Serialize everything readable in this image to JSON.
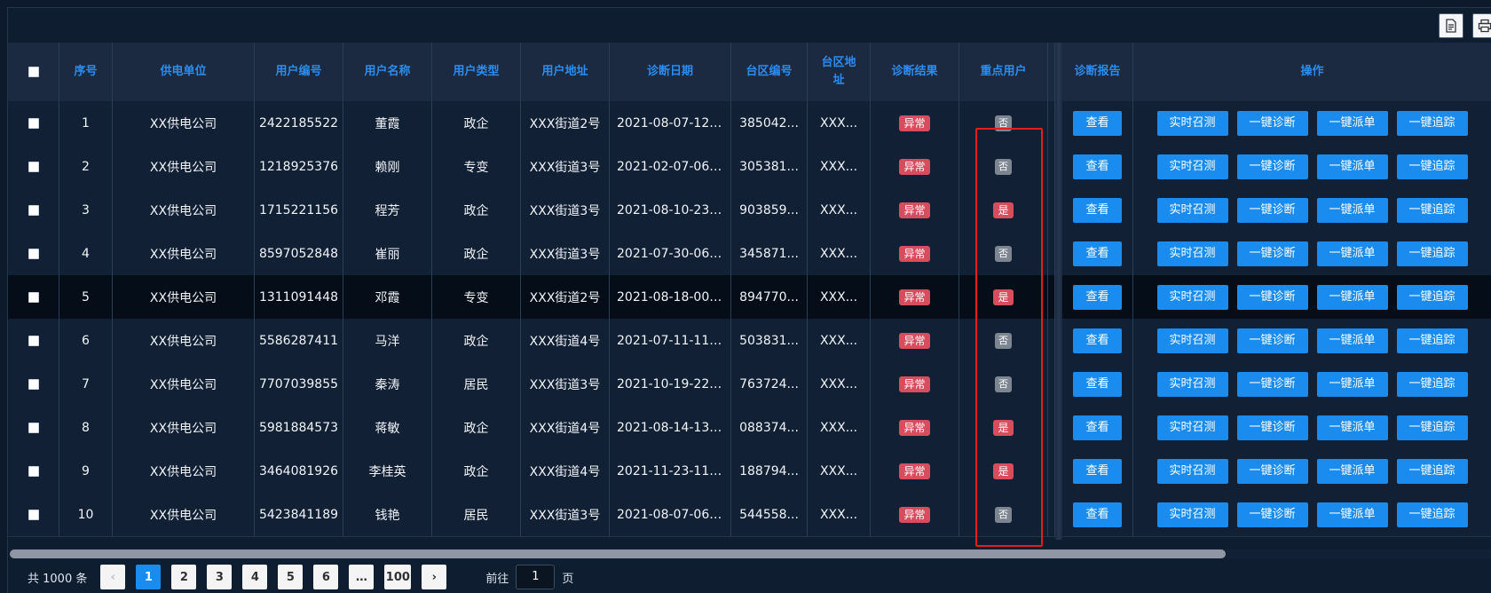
{
  "toolbar": {
    "export_icon": "document-icon",
    "print_icon": "printer-icon"
  },
  "table": {
    "columns": [
      "序号",
      "供电单位",
      "用户编号",
      "用户名称",
      "用户类型",
      "用户地址",
      "诊断日期",
      "台区编号",
      "台区地址",
      "诊断结果",
      "重点用户",
      "诊断报告",
      "操作"
    ],
    "view_label": "查看",
    "op_labels": [
      "实时召测",
      "一键诊断",
      "一键派单",
      "一键追踪"
    ],
    "rows": [
      {
        "no": "1",
        "unit": "XX供电公司",
        "user_id": "2422185522",
        "name": "董霞",
        "type": "政企",
        "address": "XXX街道2号",
        "date": "2021-08-07-12-...",
        "area_id": "385042...",
        "area_addr": "XXX...",
        "result": "异常",
        "key": "否"
      },
      {
        "no": "2",
        "unit": "XX供电公司",
        "user_id": "1218925376",
        "name": "赖刚",
        "type": "专变",
        "address": "XXX街道3号",
        "date": "2021-02-07-06-...",
        "area_id": "305381...",
        "area_addr": "XXX...",
        "result": "异常",
        "key": "否"
      },
      {
        "no": "3",
        "unit": "XX供电公司",
        "user_id": "1715221156",
        "name": "程芳",
        "type": "政企",
        "address": "XXX街道3号",
        "date": "2021-08-10-23-...",
        "area_id": "903859...",
        "area_addr": "XXX...",
        "result": "异常",
        "key": "是"
      },
      {
        "no": "4",
        "unit": "XX供电公司",
        "user_id": "8597052848",
        "name": "崔丽",
        "type": "政企",
        "address": "XXX街道3号",
        "date": "2021-07-30-06-...",
        "area_id": "345871...",
        "area_addr": "XXX...",
        "result": "异常",
        "key": "否"
      },
      {
        "no": "5",
        "unit": "XX供电公司",
        "user_id": "1311091448",
        "name": "邓霞",
        "type": "专变",
        "address": "XXX街道2号",
        "date": "2021-08-18-00-...",
        "area_id": "894770...",
        "area_addr": "XXX...",
        "result": "异常",
        "key": "是"
      },
      {
        "no": "6",
        "unit": "XX供电公司",
        "user_id": "5586287411",
        "name": "马洋",
        "type": "政企",
        "address": "XXX街道4号",
        "date": "2021-07-11-11-...",
        "area_id": "503831...",
        "area_addr": "XXX...",
        "result": "异常",
        "key": "否"
      },
      {
        "no": "7",
        "unit": "XX供电公司",
        "user_id": "7707039855",
        "name": "秦涛",
        "type": "居民",
        "address": "XXX街道3号",
        "date": "2021-10-19-22-...",
        "area_id": "763724...",
        "area_addr": "XXX...",
        "result": "异常",
        "key": "否"
      },
      {
        "no": "8",
        "unit": "XX供电公司",
        "user_id": "5981884573",
        "name": "蒋敏",
        "type": "政企",
        "address": "XXX街道4号",
        "date": "2021-08-14-13-...",
        "area_id": "088374...",
        "area_addr": "XXX...",
        "result": "异常",
        "key": "是"
      },
      {
        "no": "9",
        "unit": "XX供电公司",
        "user_id": "3464081926",
        "name": "李桂英",
        "type": "政企",
        "address": "XXX街道4号",
        "date": "2021-11-23-11-...",
        "area_id": "188794...",
        "area_addr": "XXX...",
        "result": "异常",
        "key": "是"
      },
      {
        "no": "10",
        "unit": "XX供电公司",
        "user_id": "5423841189",
        "name": "钱艳",
        "type": "居民",
        "address": "XXX街道3号",
        "date": "2021-08-07-06-...",
        "area_id": "544558...",
        "area_addr": "XXX...",
        "result": "异常",
        "key": "否"
      }
    ]
  },
  "pagination": {
    "total_text": "共 1000 条",
    "pages": [
      "1",
      "2",
      "3",
      "4",
      "5",
      "6",
      "…",
      "100"
    ],
    "current": "1",
    "prev": "‹",
    "next": "›",
    "goto_prefix": "前往",
    "goto_value": "1",
    "goto_suffix": "页"
  },
  "colors": {
    "accent": "#1a8cf0",
    "danger": "#d84d5d",
    "neutral": "#7d8591",
    "highlight_border": "#e51d1d"
  }
}
